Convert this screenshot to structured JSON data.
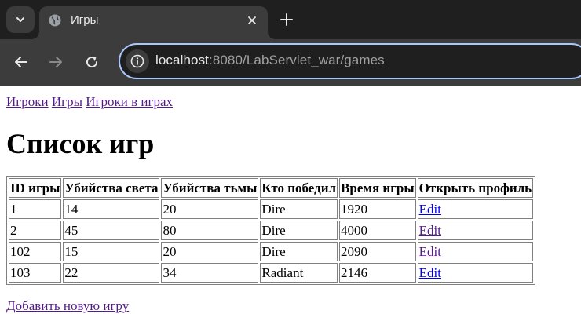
{
  "browser": {
    "tab_title": "Игры",
    "url_host": "localhost",
    "url_rest": ":8080/LabServlet_war/games"
  },
  "nav": {
    "players": "Игроки",
    "games": "Игры",
    "players_in_games": "Игроки в играх"
  },
  "page_title": "Список игр",
  "table": {
    "headers": [
      "ID игры",
      "Убийства света",
      "Убийства тьмы",
      "Кто победил",
      "Время игры",
      "Открыть профиль"
    ],
    "rows": [
      {
        "id": "1",
        "light_kills": "14",
        "dark_kills": "20",
        "winner": "Dire",
        "duration": "1920",
        "action": "Edit"
      },
      {
        "id": "2",
        "light_kills": "45",
        "dark_kills": "80",
        "winner": "Dire",
        "duration": "4000",
        "action": "Edit"
      },
      {
        "id": "102",
        "light_kills": "15",
        "dark_kills": "20",
        "winner": "Dire",
        "duration": "2090",
        "action": "Edit"
      },
      {
        "id": "103",
        "light_kills": "22",
        "dark_kills": "34",
        "winner": "Radiant",
        "duration": "2146",
        "action": "Edit"
      }
    ]
  },
  "add_game_link": "Добавить новую игру",
  "colors": {
    "visited_link": "#551a8b",
    "unvisited_link": "#0000ee",
    "omnibox_focus": "#a8c7fa"
  }
}
